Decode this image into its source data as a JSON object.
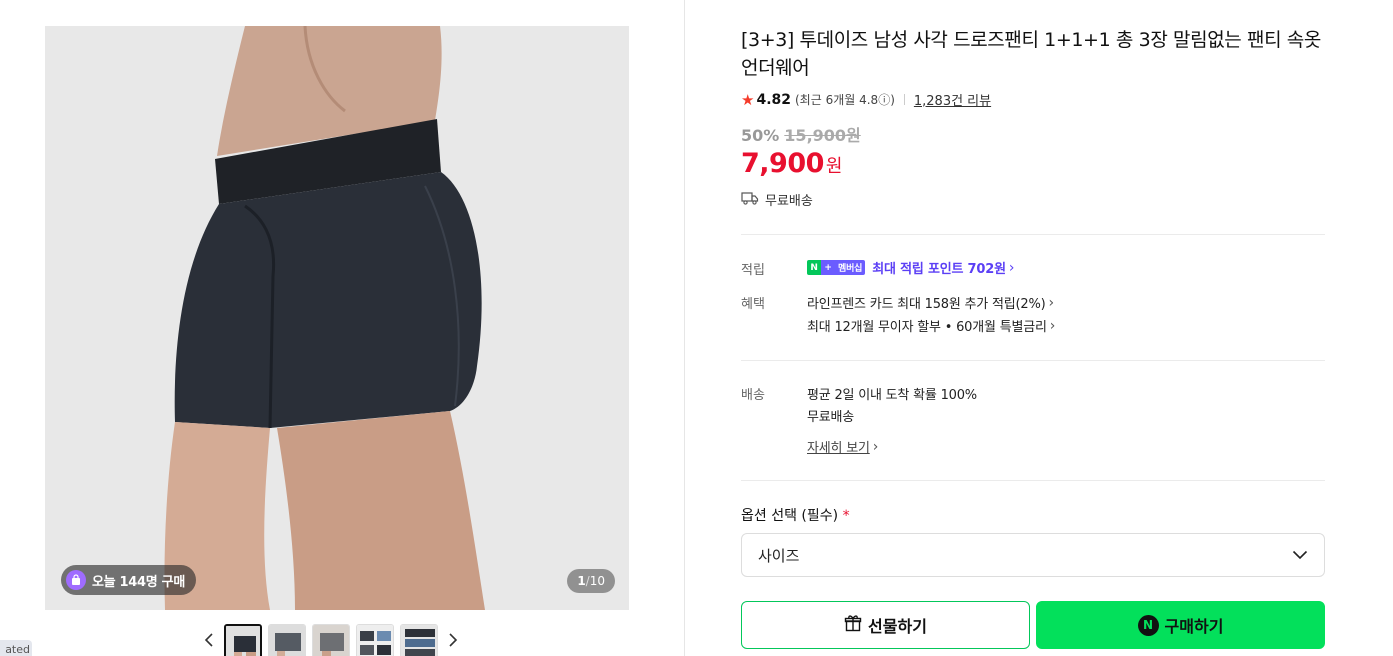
{
  "gallery": {
    "buy_count_text": "오늘 144명 구매",
    "page_current": "1",
    "page_sep": "/",
    "page_total": "10",
    "prev_icon": "chevron-left-icon",
    "next_icon": "chevron-right-icon"
  },
  "corner_tag": "ated",
  "product": {
    "title": "[3+3] 투데이즈 남성 사각 드로즈팬티 1+1+1 총 3장 말림없는 팬티 속옷 언더웨어",
    "rating": "4.82",
    "recent_rating": "(최근 6개월 4.8ⓘ)",
    "review_count": "1,283건 리뷰",
    "discount_pct": "50%",
    "original_price": "15,900원",
    "price": "7,900",
    "currency": "원",
    "free_shipping": "무료배송"
  },
  "benefits": {
    "points_label": "적립",
    "membership_n": "N",
    "membership_plus": "+",
    "membership_badge": "멤버십",
    "points_text": "최대 적립 포인트 702원",
    "benefit_label": "혜택",
    "card_benefit": "라인프렌즈 카드 최대 158원 추가 적립(2%)",
    "installment_benefit": "최대 12개월 무이자 할부 • 60개월 특별금리"
  },
  "delivery": {
    "label": "배송",
    "arrival": "평균 2일 이내 도착 확률 100%",
    "fee": "무료배송",
    "detail_link": "자세히 보기"
  },
  "options": {
    "label": "옵션 선택 (필수)",
    "required_mark": "*",
    "select_value": "사이즈"
  },
  "actions": {
    "gift_label": "선물하기",
    "buy_n": "N",
    "buy_label": "구매하기"
  },
  "colors": {
    "price_red": "#e8102f",
    "naver_green": "#03c75a",
    "membership_purple": "#5b3ff5"
  }
}
